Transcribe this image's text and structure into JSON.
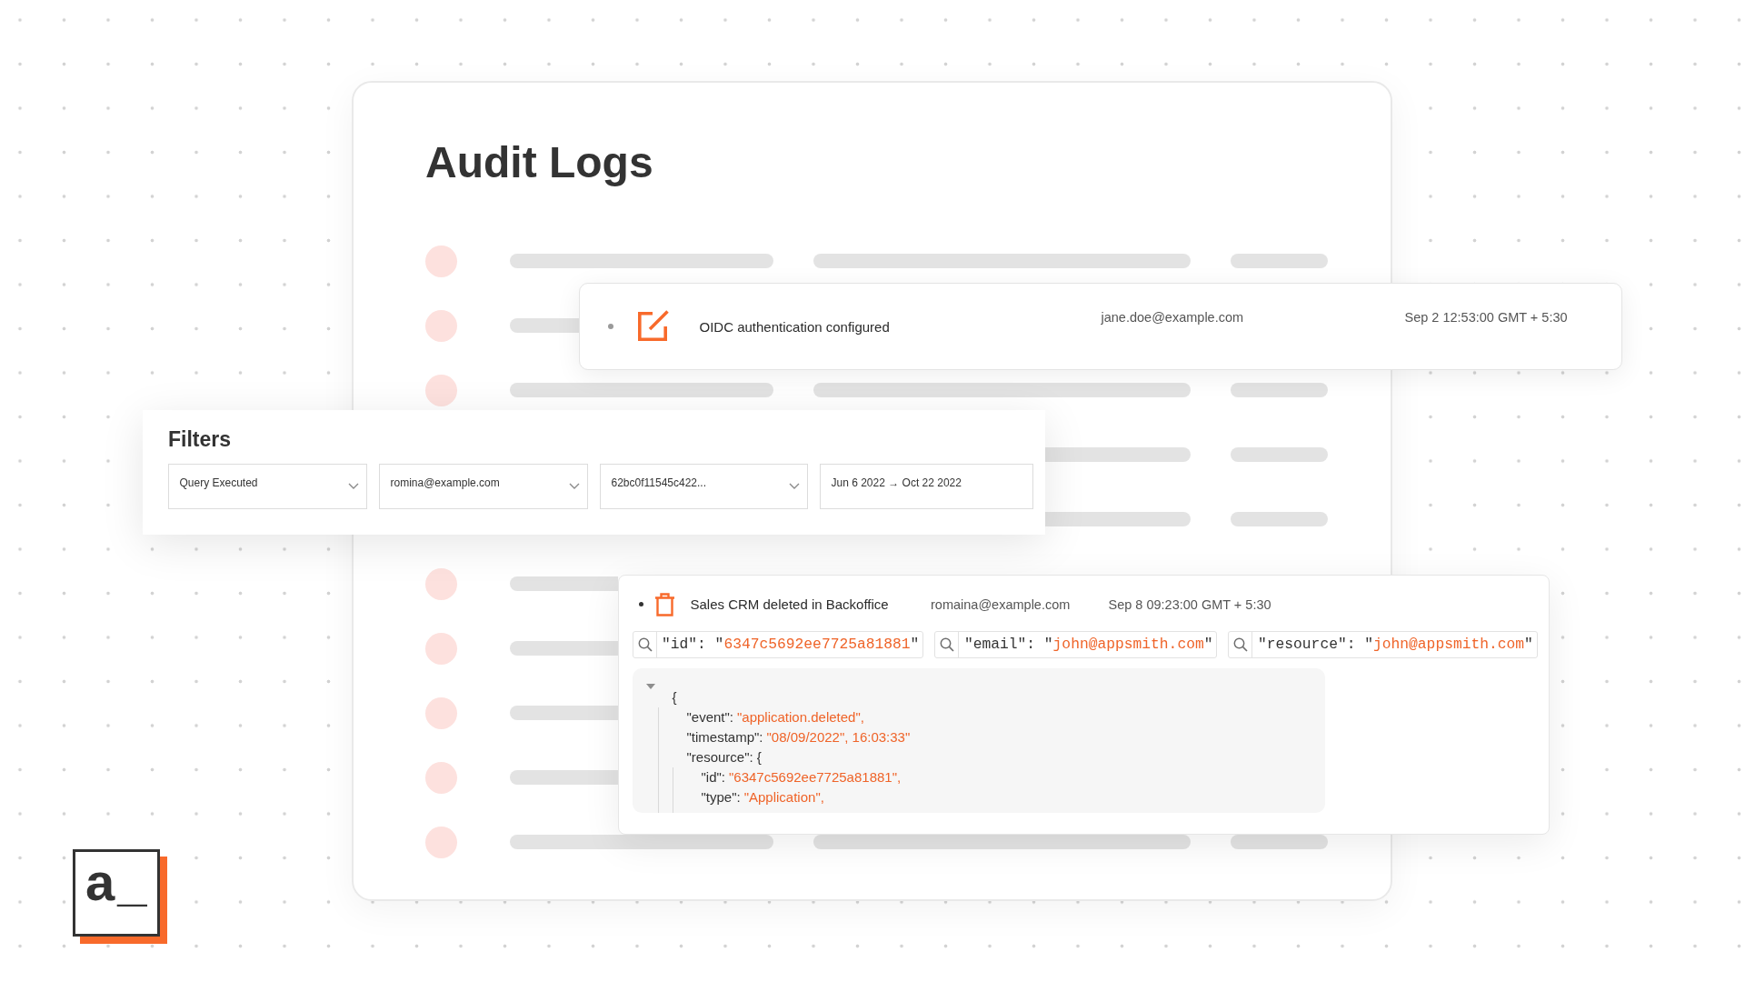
{
  "page_title": "Audit Logs",
  "recent_event": {
    "description": "OIDC authentication configured",
    "user": "jane.doe@example.com",
    "time": "Sep 2 12:53:00 GMT + 5:30"
  },
  "filters": {
    "title": "Filters",
    "fields": [
      {
        "kind": "dropdown",
        "value": "Query Executed"
      },
      {
        "kind": "dropdown",
        "value": "romina@example.com"
      },
      {
        "kind": "dropdown",
        "value": "62bc0f11545c422..."
      },
      {
        "kind": "date_range",
        "value": "Jun 6 2022 → Oct 22 2022"
      }
    ]
  },
  "expanded_event": {
    "description": "Sales CRM deleted in Backoffice",
    "user": "romaina@example.com",
    "time": "Sep 8 09:23:00 GMT + 5:30",
    "search_terms": [
      {
        "prefix": "\"id\": \"",
        "value": "6347c5692ee7725a81881",
        "suffix": "\""
      },
      {
        "prefix": "\"email\": \"",
        "value": "john@appsmith.com",
        "suffix": "\""
      },
      {
        "prefix": "\"resource\": \"",
        "value": "john@appsmith.com",
        "suffix": "\""
      }
    ],
    "json_tree": {
      "text": "{",
      "expanded": true,
      "children": [
        {
          "text": "\"event\":",
          "value": "\"application.deleted\","
        },
        {
          "text": "\"timestamp\":",
          "value": "\"08/09/2022\", 16:03:33\""
        },
        {
          "text": "\"resource\": {",
          "children": [
            {
              "text": "\"id\":",
              "value": "\"6347c5692ee7725a81881\","
            },
            {
              "text": "\"type\":",
              "value": "\"Application\","
            }
          ]
        }
      ]
    }
  },
  "logo": {
    "text": "a_"
  }
}
